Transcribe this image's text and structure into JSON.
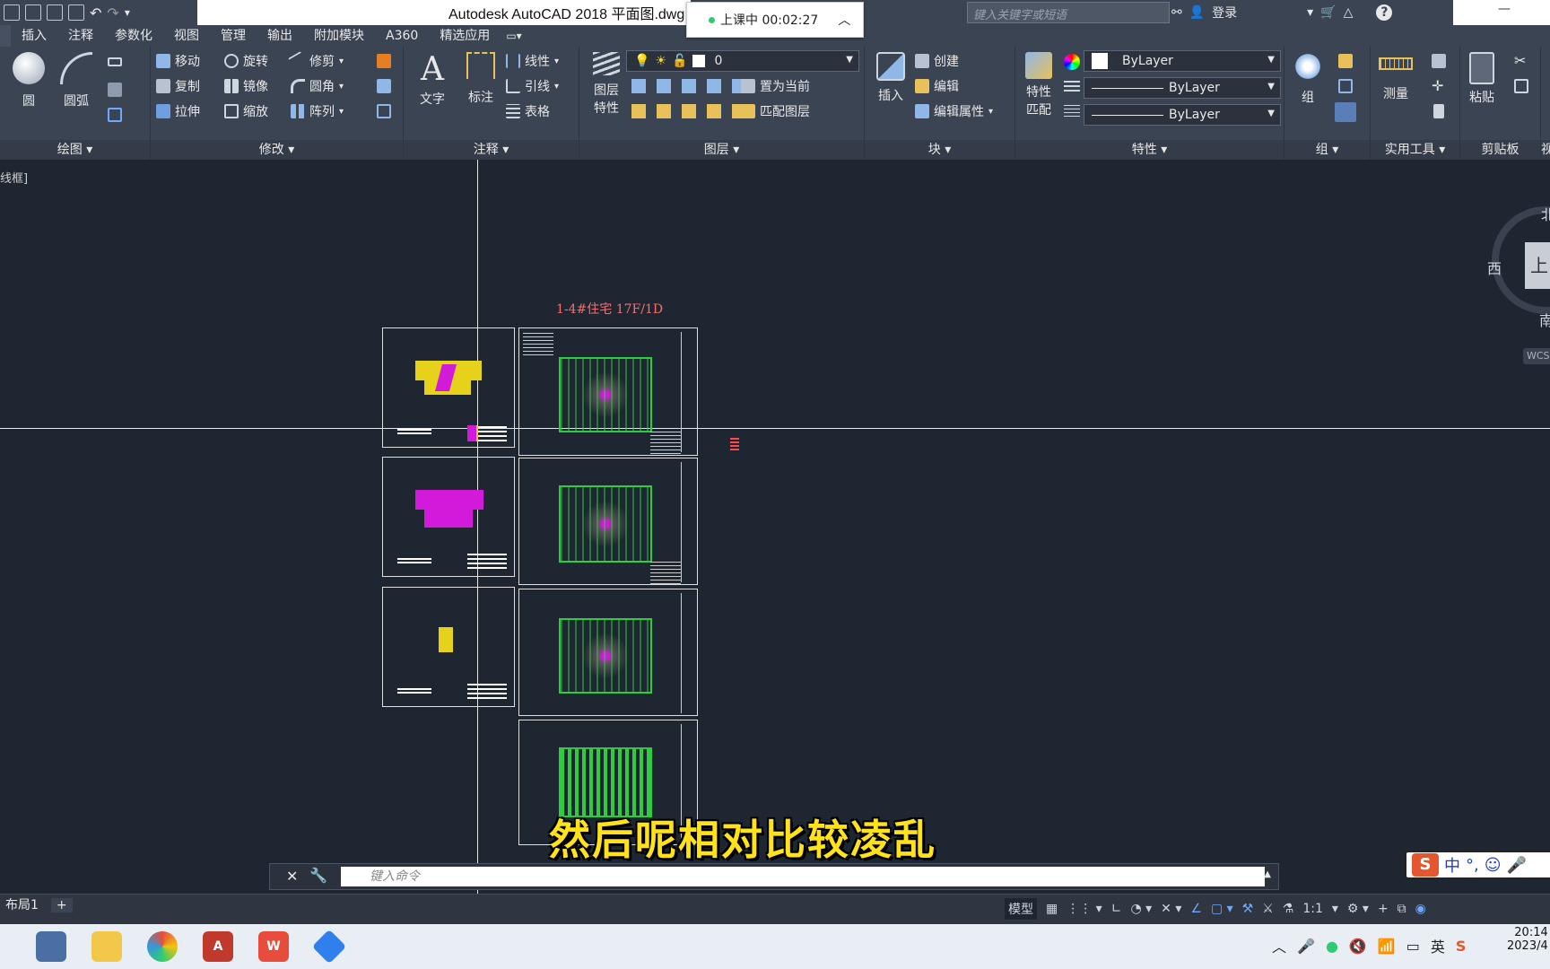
{
  "window": {
    "title": "Autodesk AutoCAD 2018    平面图.dwg"
  },
  "recording": {
    "label": "上课中 00:02:27"
  },
  "search": {
    "placeholder": "键入关键字或短语"
  },
  "account": {
    "login": "登录"
  },
  "menu_tabs": [
    "插入",
    "注释",
    "参数化",
    "视图",
    "管理",
    "输出",
    "附加模块",
    "A360",
    "精选应用"
  ],
  "panels": {
    "draw": {
      "title": "绘图",
      "circle": "圆",
      "arc": "圆弧"
    },
    "modify": {
      "title": "修改",
      "move": "移动",
      "rotate": "旋转",
      "trim": "修剪",
      "copy": "复制",
      "mirror": "镜像",
      "fillet": "圆角",
      "stretch": "拉伸",
      "scale": "缩放",
      "array": "阵列"
    },
    "annotation": {
      "title": "注释",
      "text": "文字",
      "dimension": "标注",
      "linear": "线性",
      "leader": "引线",
      "table": "表格"
    },
    "layers": {
      "title": "图层",
      "props": "图层\n特性",
      "props1": "图层",
      "props2": "特性",
      "current_layer": "0",
      "set_current": "置为当前",
      "match_layer": "匹配图层"
    },
    "block": {
      "title": "块",
      "insert": "插入",
      "create": "创建",
      "edit": "编辑",
      "edit_attr": "编辑属性"
    },
    "properties": {
      "title": "特性",
      "match1": "特性",
      "match2": "匹配",
      "color": "ByLayer",
      "linetype": "ByLayer",
      "lineweight": "ByLayer"
    },
    "group": {
      "title": "组",
      "label": "组"
    },
    "utilities": {
      "title": "实用工具",
      "measure": "测量"
    },
    "clipboard": {
      "title": "剪贴板",
      "paste": "粘贴"
    },
    "view_partial": "视"
  },
  "viewport": {
    "label": "[-][俯视][二维线框]",
    "label_visible": "线框]"
  },
  "drawing": {
    "title": "1-4#住宅 17F/1D"
  },
  "viewcube": {
    "north": "北",
    "west": "西",
    "south": "南",
    "top": "上",
    "wcs": "WCS"
  },
  "subtitle": "然后呢相对比较凌乱",
  "command": {
    "placeholder": "键入命令"
  },
  "status": {
    "model": "模型",
    "scale": "1:1"
  },
  "layout_tab": "布局1",
  "taskbar": {
    "time": "20:14",
    "date": "2023/4",
    "lang": "英"
  },
  "ime": {
    "mode": "中"
  },
  "colors": {
    "accent_title": "#ff6b6b",
    "subtitle": "#ffe21a",
    "background": "#1e2631",
    "ribbon": "#3b4453"
  }
}
